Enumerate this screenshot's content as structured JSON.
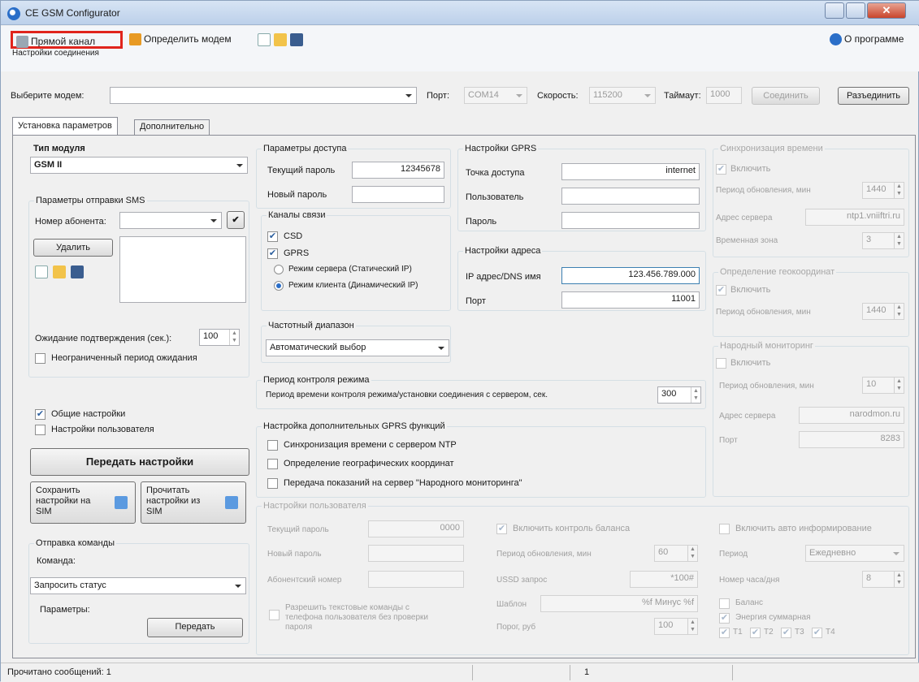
{
  "window": {
    "title": "CE GSM Configurator"
  },
  "toolbar": {
    "direct_channel": "Прямой канал",
    "detect_modem": "Определить модем",
    "about": "О программе",
    "connection_settings_label": "Настройки соединения"
  },
  "connection": {
    "select_modem_label": "Выберите модем:",
    "modem_value": "",
    "port_label": "Порт:",
    "port_value": "COM14",
    "speed_label": "Скорость:",
    "speed_value": "115200",
    "timeout_label": "Таймаут:",
    "timeout_value": "1000",
    "connect": "Соединить",
    "disconnect": "Разъединить"
  },
  "tabs": [
    "Установка параметров",
    "Дополнительно"
  ],
  "module": {
    "title": "Тип модуля",
    "value": "GSM II"
  },
  "sms": {
    "title": "Параметры отправки SMS",
    "subscriber_label": "Номер абонента:",
    "subscriber_value": "",
    "delete": "Удалить",
    "wait_label": "Ожидание подтверждения (сек.):",
    "wait_value": "100",
    "unlimited": "Неограниченный период ожидания"
  },
  "general_settings": "Общие настройки",
  "user_settings": "Настройки пользователя",
  "transfer": "Передать настройки",
  "save_sim": "Сохранить настройки на SIM",
  "read_sim": "Прочитать настройки из SIM",
  "command": {
    "title": "Отправка команды",
    "label": "Команда:",
    "value": "Запросить статус",
    "params_label": "Параметры:",
    "send": "Передать"
  },
  "access": {
    "title": "Параметры доступа",
    "current_label": "Текущий пароль",
    "current_value": "12345678",
    "new_label": "Новый пароль",
    "new_value": ""
  },
  "channels": {
    "title": "Каналы связи",
    "csd": "CSD",
    "gprs": "GPRS",
    "server_mode": "Режим сервера (Статический IP)",
    "client_mode": "Режим клиента (Динамический IP)"
  },
  "freq": {
    "title": "Частотный диапазон",
    "value": "Автоматический выбор"
  },
  "control": {
    "title": "Период контроля режима",
    "label": "Период времени контроля режима/установки соединения с сервером, сек.",
    "value": "300"
  },
  "extra_gprs": {
    "title": "Настройка дополнительных GPRS функций",
    "ntp": "Синхронизация времени с сервером NTP",
    "geo": "Определение географических координат",
    "monitor": "Передача показаний на сервер \"Народного мониторинга\""
  },
  "gprs": {
    "title": "Настройки GPRS",
    "ap_label": "Точка доступа",
    "ap_value": "internet",
    "user_label": "Пользователь",
    "user_value": "",
    "pass_label": "Пароль",
    "pass_value": ""
  },
  "address": {
    "title": "Настройки адреса",
    "ip_label": "IP адрес/DNS имя",
    "ip_value": "123.456.789.000",
    "port_label": "Порт",
    "port_value": "11001"
  },
  "timesync": {
    "title": "Синхронизация времени",
    "enable": "Включить",
    "period_label": "Период обновления, мин",
    "period_value": "1440",
    "server_label": "Адрес сервера",
    "server_value": "ntp1.vniiftri.ru",
    "zone_label": "Временная зона",
    "zone_value": "3"
  },
  "geo": {
    "title": "Определение геокоординат",
    "enable": "Включить",
    "period_label": "Период обновления, мин",
    "period_value": "1440"
  },
  "narodmon": {
    "title": "Народный мониторинг",
    "enable": "Включить",
    "period_label": "Период обновления, мин",
    "period_value": "10",
    "server_label": "Адрес сервера",
    "server_value": "narodmon.ru",
    "port_label": "Порт",
    "port_value": "8283"
  },
  "user_panel": {
    "title": "Настройки пользователя",
    "current_label": "Текущий пароль",
    "current_value": "0000",
    "new_label": "Новый пароль",
    "subscriber_label": "Абонентский номер",
    "allow_text": "Разрешить текстовые команды с телефона пользователя без проверки пароля",
    "balance_enable": "Включить контроль баланса",
    "balance_period_label": "Период обновления, мин",
    "balance_period_value": "60",
    "ussd_label": "USSD запрос",
    "ussd_value": "*100#",
    "template_label": "Шаблон",
    "template_value": "%f Минус %f",
    "threshold_label": "Порог, руб",
    "threshold_value": "100",
    "auto_info": "Включить авто информирование",
    "period_label": "Период",
    "period_value": "Ежедневно",
    "hour_label": "Номер часа/дня",
    "hour_value": "8",
    "balance": "Баланс",
    "energy": "Энергия суммарная",
    "tariffs": [
      "T1",
      "T2",
      "T3",
      "T4"
    ]
  },
  "status": {
    "messages": "Прочитано сообщений: 1",
    "count": "1"
  }
}
